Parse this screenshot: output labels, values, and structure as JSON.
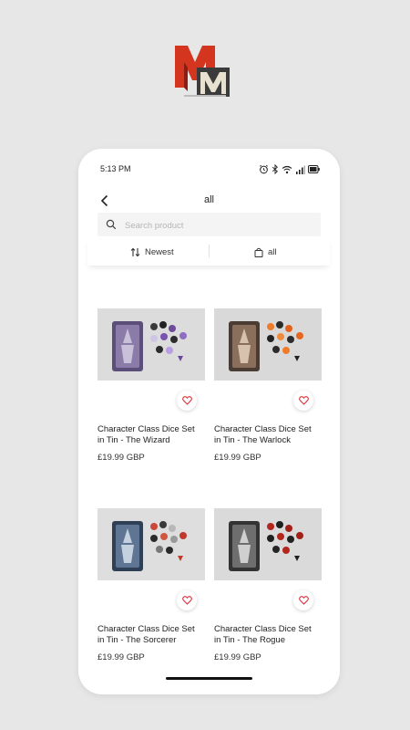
{
  "status_bar": {
    "time": "5:13 PM"
  },
  "header": {
    "title": "all"
  },
  "search": {
    "placeholder": "Search product"
  },
  "filters": {
    "sort_label": "Newest",
    "category_label": "all"
  },
  "products": [
    {
      "name": "Character Class Dice Set in Tin - The Wizard",
      "price": "£19.99 GBP"
    },
    {
      "name": "Character Class Dice Set in Tin - The Warlock",
      "price": "£19.99 GBP"
    },
    {
      "name": "Character Class Dice Set in Tin - The Sorcerer",
      "price": "£19.99 GBP"
    },
    {
      "name": "Character Class Dice Set in Tin - The Rogue",
      "price": "£19.99 GBP"
    }
  ],
  "colors": {
    "accent": "#e0313a",
    "background": "#e7e7e7",
    "logo_red": "#d3351f"
  }
}
